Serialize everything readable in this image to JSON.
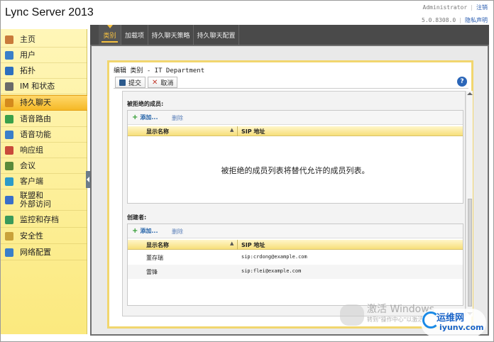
{
  "header": {
    "app_title": "Lync Server 2013",
    "user": "Administrator",
    "logout": "注销",
    "version": "5.0.8308.0",
    "privacy": "隐私声明"
  },
  "sidebar": {
    "items": [
      {
        "label": "主页",
        "icon": "home-icon",
        "color": "#c97a3a"
      },
      {
        "label": "用户",
        "icon": "users-icon",
        "color": "#3a7fc9"
      },
      {
        "label": "拓扑",
        "icon": "topology-icon",
        "color": "#2c6fbf"
      },
      {
        "label": "IM 和状态",
        "icon": "chat-presence-icon",
        "color": "#6a6a6a"
      },
      {
        "label": "持久聊天",
        "icon": "persistent-chat-icon",
        "color": "#d48a1c",
        "active": true
      },
      {
        "label": "语音路由",
        "icon": "voice-routing-icon",
        "color": "#3aa04a"
      },
      {
        "label": "语音功能",
        "icon": "voice-features-icon",
        "color": "#3a7fc9"
      },
      {
        "label": "响应组",
        "icon": "response-group-icon",
        "color": "#c94a3a"
      },
      {
        "label": "会议",
        "icon": "conferencing-icon",
        "color": "#5a8a3a"
      },
      {
        "label": "客户端",
        "icon": "clients-icon",
        "color": "#2c9ac9"
      },
      {
        "label": "联盟和\n外部访问",
        "icon": "federation-icon",
        "color": "#3a6fc9"
      },
      {
        "label": "监控和存档",
        "icon": "monitoring-icon",
        "color": "#3a9a5a"
      },
      {
        "label": "安全性",
        "icon": "security-icon",
        "color": "#c9a23a"
      },
      {
        "label": "网络配置",
        "icon": "network-icon",
        "color": "#3a7fc9"
      }
    ]
  },
  "tabs": [
    {
      "label": "类别",
      "active": true
    },
    {
      "label": "加载项"
    },
    {
      "label": "持久聊天策略"
    },
    {
      "label": "持久聊天配置"
    }
  ],
  "editor": {
    "title": "编辑 类别 - IT Department",
    "commit_label": "提交",
    "cancel_label": "取消",
    "help_label": "?"
  },
  "denied_members": {
    "section_label": "被拒绝的成员:",
    "add_label": "添加...",
    "remove_label": "删除",
    "col_display_name": "显示名称",
    "col_sip": "SIP 地址",
    "empty_message": "被拒绝的成员列表将替代允许的成员列表。"
  },
  "creators": {
    "section_label": "创建者:",
    "add_label": "添加...",
    "remove_label": "删除",
    "col_display_name": "显示名称",
    "col_sip": "SIP 地址",
    "rows": [
      {
        "name": "董存瑞",
        "sip": "sip:crdong@example.com"
      },
      {
        "name": "雷锋",
        "sip": "sip:flei@example.com"
      }
    ]
  },
  "watermark": {
    "title": "激活 Windows",
    "subtitle": "转到\"操作中心\"以激活",
    "logo_top": "运维网",
    "logo_bottom": "iyunv.com"
  }
}
